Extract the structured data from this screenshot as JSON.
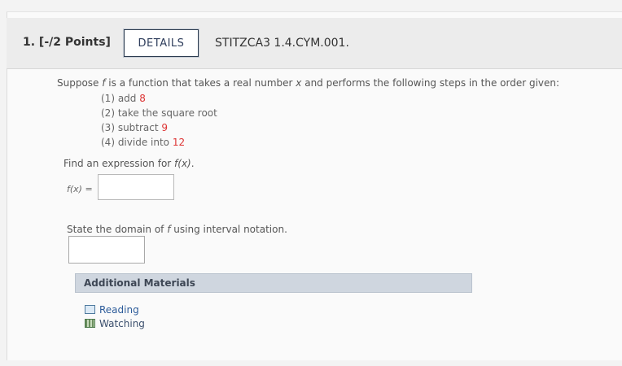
{
  "question": {
    "number_points": "1.  [-/2 Points]",
    "details_label": "DETAILS",
    "code": "STITZCA3 1.4.CYM.001."
  },
  "prompt": {
    "pre": "Suppose ",
    "f": "f",
    "mid": " is a function that takes a real number ",
    "x": "x",
    "post": " and performs the following steps in the order given:"
  },
  "steps": [
    {
      "text": "(1) add ",
      "value": "8"
    },
    {
      "text": "(2) take the square root",
      "value": ""
    },
    {
      "text": "(3) subtract ",
      "value": "9"
    },
    {
      "text": "(4) divide into ",
      "value": "12"
    }
  ],
  "find": {
    "pre": "Find an expression for ",
    "fx": "f(x)",
    "post": "."
  },
  "fx_label": "f(x) =",
  "domain": {
    "pre": "State the domain of ",
    "f": "f",
    "post": " using interval notation."
  },
  "materials": {
    "title": "Additional Materials",
    "items": [
      {
        "label": "Reading",
        "icon": "book-icon"
      },
      {
        "label": "Watching",
        "icon": "video-icon"
      }
    ]
  }
}
